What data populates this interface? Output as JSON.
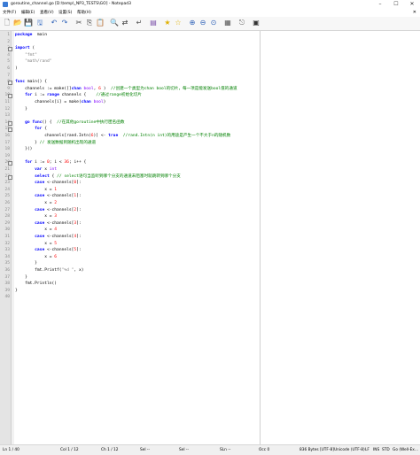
{
  "window": {
    "title": "goroutine_channel.go [D:\\temp\\_NP3_TESTS\\GO] - Notepad3",
    "controls": [
      "–",
      "☐",
      "✕"
    ],
    "app_icon": "notepad3-app-icon"
  },
  "menu": {
    "items": [
      "文件(F)",
      "编辑(E)",
      "查看(V)",
      "设置(S)",
      "帮助(H)"
    ],
    "close": "✕"
  },
  "toolbar": {
    "buttons": [
      {
        "icon": "new-file-icon",
        "glyph": "🗋"
      },
      {
        "icon": "open-folder-icon",
        "glyph": "📂"
      },
      {
        "icon": "save-icon",
        "glyph": "💾"
      },
      {
        "icon": "save-as-icon",
        "glyph": "🖫"
      },
      {
        "icon": "undo-icon",
        "glyph": "↶"
      },
      {
        "icon": "redo-icon",
        "glyph": "↷"
      },
      {
        "icon": "cut-icon",
        "glyph": "✂"
      },
      {
        "icon": "copy-icon",
        "glyph": "⎘"
      },
      {
        "icon": "paste-icon",
        "glyph": "📋"
      },
      {
        "icon": "find-icon",
        "glyph": "🔍"
      },
      {
        "icon": "replace-icon",
        "glyph": "⇄"
      },
      {
        "icon": "word-wrap-icon",
        "glyph": "↵"
      },
      {
        "icon": "schema-icon",
        "glyph": "▤"
      },
      {
        "icon": "bookmark-toggle-icon",
        "glyph": "★"
      },
      {
        "icon": "bookmark-clear-icon",
        "glyph": "☆"
      },
      {
        "icon": "zoom-in-icon",
        "glyph": "⊕"
      },
      {
        "icon": "zoom-out-icon",
        "glyph": "⊖"
      },
      {
        "icon": "reset-zoom-icon",
        "glyph": "⊙"
      },
      {
        "icon": "customize-schemes-icon",
        "glyph": "▦"
      },
      {
        "icon": "exit-icon",
        "glyph": "⎋"
      },
      {
        "icon": "favorites-icon",
        "glyph": "▣"
      }
    ]
  },
  "editor": {
    "lines": [
      {
        "n": "1",
        "fold": "",
        "segs": [
          [
            "kw",
            "package"
          ],
          [
            "",
            "  main"
          ]
        ]
      },
      {
        "n": "2",
        "fold": "",
        "segs": []
      },
      {
        "n": "3",
        "fold": "□",
        "segs": [
          [
            "kw",
            "import"
          ],
          [
            "",
            " ("
          ]
        ]
      },
      {
        "n": "4",
        "fold": "",
        "segs": [
          [
            "",
            "    "
          ],
          [
            "str",
            "\"fmt\""
          ]
        ]
      },
      {
        "n": "5",
        "fold": "",
        "segs": [
          [
            "",
            "    "
          ],
          [
            "str",
            "\"math/rand\""
          ]
        ]
      },
      {
        "n": "6",
        "fold": "",
        "segs": [
          [
            "",
            ")"
          ]
        ]
      },
      {
        "n": "7",
        "fold": "",
        "segs": []
      },
      {
        "n": "8",
        "fold": "□",
        "segs": [
          [
            "kw",
            "func"
          ],
          [
            "",
            " main() {"
          ]
        ]
      },
      {
        "n": "9",
        "fold": "",
        "segs": [
          [
            "",
            "    channels := "
          ],
          [
            "fn",
            "make"
          ],
          [
            "",
            "([]"
          ],
          [
            "kw",
            "chan"
          ],
          [
            "",
            " "
          ],
          [
            "ty",
            "bool"
          ],
          [
            "",
            ", "
          ],
          [
            "num",
            "6"
          ],
          [
            "",
            " )  "
          ],
          [
            "cmt",
            "//创建一个类型为chan bool的切片，每一项是能发送bool值的通道"
          ]
        ]
      },
      {
        "n": "10",
        "fold": "□",
        "segs": [
          [
            "",
            "    "
          ],
          [
            "kw",
            "for"
          ],
          [
            "",
            " i := "
          ],
          [
            "kw",
            "range"
          ],
          [
            "",
            " channels {    "
          ],
          [
            "cmt",
            "//通过range初始化切片"
          ]
        ]
      },
      {
        "n": "11",
        "fold": "",
        "segs": [
          [
            "",
            "        channels[i] = "
          ],
          [
            "fn",
            "make"
          ],
          [
            "",
            "("
          ],
          [
            "kw",
            "chan"
          ],
          [
            "",
            " "
          ],
          [
            "ty",
            "bool"
          ],
          [
            "",
            ")"
          ]
        ]
      },
      {
        "n": "12",
        "fold": "",
        "segs": [
          [
            "",
            "    }"
          ]
        ]
      },
      {
        "n": "13",
        "fold": "",
        "segs": []
      },
      {
        "n": "14",
        "fold": "□",
        "segs": [
          [
            "",
            "    "
          ],
          [
            "kw",
            "go"
          ],
          [
            "",
            " "
          ],
          [
            "kw",
            "func"
          ],
          [
            "",
            "() {  "
          ],
          [
            "cmt",
            "//在其他goroutine中执行匿名函数"
          ]
        ]
      },
      {
        "n": "15",
        "fold": "□",
        "segs": [
          [
            "",
            "        "
          ],
          [
            "kw",
            "for"
          ],
          [
            "",
            " {"
          ]
        ]
      },
      {
        "n": "16",
        "fold": "",
        "segs": [
          [
            "",
            "            channels[rand.Intn("
          ],
          [
            "num",
            "6"
          ],
          [
            "",
            ")] <- "
          ],
          [
            "kw",
            "true"
          ],
          [
            "",
            "  "
          ],
          [
            "cmt",
            "//rand.Intn(n int)的用途是产生一个不大于n的随机数"
          ]
        ]
      },
      {
        "n": "17",
        "fold": "",
        "segs": [
          [
            "",
            "        } "
          ],
          [
            "cmt",
            "// 发送数据到随机出现的通道"
          ]
        ]
      },
      {
        "n": "18",
        "fold": "",
        "segs": [
          [
            "",
            "    }()"
          ]
        ]
      },
      {
        "n": "19",
        "fold": "",
        "segs": []
      },
      {
        "n": "20",
        "fold": "□",
        "segs": [
          [
            "",
            "    "
          ],
          [
            "kw",
            "for"
          ],
          [
            "",
            " i := "
          ],
          [
            "num",
            "0"
          ],
          [
            "",
            "; i < "
          ],
          [
            "num",
            "36"
          ],
          [
            "",
            "; i++ {"
          ]
        ]
      },
      {
        "n": "21",
        "fold": "",
        "segs": [
          [
            "",
            "        "
          ],
          [
            "kw",
            "var"
          ],
          [
            "",
            " x "
          ],
          [
            "ty",
            "int"
          ]
        ]
      },
      {
        "n": "22",
        "fold": "□",
        "segs": [
          [
            "",
            "        "
          ],
          [
            "kw",
            "select"
          ],
          [
            "",
            " { "
          ],
          [
            "cmt",
            "// select语句当监听到哪个分支的通道未阻塞时就跳转到哪个分支"
          ]
        ]
      },
      {
        "n": "23",
        "fold": "",
        "segs": [
          [
            "",
            "        "
          ],
          [
            "kw",
            "case"
          ],
          [
            "",
            " <-channels["
          ],
          [
            "num",
            "0"
          ],
          [
            "",
            "]:"
          ]
        ]
      },
      {
        "n": "24",
        "fold": "",
        "segs": [
          [
            "",
            "            x = "
          ],
          [
            "num",
            "1"
          ]
        ]
      },
      {
        "n": "25",
        "fold": "",
        "segs": [
          [
            "",
            "        "
          ],
          [
            "kw",
            "case"
          ],
          [
            "",
            " <-channels["
          ],
          [
            "num",
            "1"
          ],
          [
            "",
            "]:"
          ]
        ]
      },
      {
        "n": "26",
        "fold": "",
        "segs": [
          [
            "",
            "            x = "
          ],
          [
            "num",
            "2"
          ]
        ]
      },
      {
        "n": "27",
        "fold": "",
        "segs": [
          [
            "",
            "        "
          ],
          [
            "kw",
            "case"
          ],
          [
            "",
            " <-channels["
          ],
          [
            "num",
            "2"
          ],
          [
            "",
            "]:"
          ]
        ]
      },
      {
        "n": "28",
        "fold": "",
        "segs": [
          [
            "",
            "            x = "
          ],
          [
            "num",
            "3"
          ]
        ]
      },
      {
        "n": "29",
        "fold": "",
        "segs": [
          [
            "",
            "        "
          ],
          [
            "kw",
            "case"
          ],
          [
            "",
            " <-channels["
          ],
          [
            "num",
            "3"
          ],
          [
            "",
            "]:"
          ]
        ]
      },
      {
        "n": "30",
        "fold": "",
        "segs": [
          [
            "",
            "            x = "
          ],
          [
            "num",
            "4"
          ]
        ]
      },
      {
        "n": "31",
        "fold": "",
        "segs": [
          [
            "",
            "        "
          ],
          [
            "kw",
            "case"
          ],
          [
            "",
            " <-channels["
          ],
          [
            "num",
            "4"
          ],
          [
            "",
            "]:"
          ]
        ]
      },
      {
        "n": "32",
        "fold": "",
        "segs": [
          [
            "",
            "            x = "
          ],
          [
            "num",
            "5"
          ]
        ]
      },
      {
        "n": "33",
        "fold": "",
        "segs": [
          [
            "",
            "        "
          ],
          [
            "kw",
            "case"
          ],
          [
            "",
            " <-channels["
          ],
          [
            "num",
            "5"
          ],
          [
            "",
            "]:"
          ]
        ]
      },
      {
        "n": "34",
        "fold": "",
        "segs": [
          [
            "",
            "            x = "
          ],
          [
            "num",
            "6"
          ]
        ]
      },
      {
        "n": "35",
        "fold": "",
        "segs": [
          [
            "",
            "        }"
          ]
        ]
      },
      {
        "n": "36",
        "fold": "",
        "segs": [
          [
            "",
            "        fmt.Printf("
          ],
          [
            "str",
            "\"%d \""
          ],
          [
            "",
            ", x)"
          ]
        ]
      },
      {
        "n": "37",
        "fold": "",
        "segs": [
          [
            "",
            "    }"
          ]
        ]
      },
      {
        "n": "38",
        "fold": "",
        "segs": [
          [
            "",
            "    fmt.Println()"
          ]
        ]
      },
      {
        "n": "39",
        "fold": "",
        "segs": [
          [
            "",
            "}"
          ]
        ]
      },
      {
        "n": "40",
        "fold": "",
        "segs": []
      }
    ]
  },
  "status": {
    "ln": "Ln  1 / 40",
    "col": "Col  1 / 12",
    "ch": "Ch  1 / 12",
    "sel": "Sel  --",
    "sel2": "Sel  --",
    "sln": "SLn  --",
    "occ": "Occ  0",
    "size": "836 Bytes [UTF-8]",
    "encoding": "Unicode (UTF-8)",
    "eol": "LF",
    "ins": "INS",
    "std": "STD",
    "lang": "Go (Well-Ex..."
  },
  "colors": {
    "keyword": "#0000ff",
    "type": "#8000ff",
    "string": "#808080",
    "number": "#ff0000",
    "comment": "#008000"
  }
}
